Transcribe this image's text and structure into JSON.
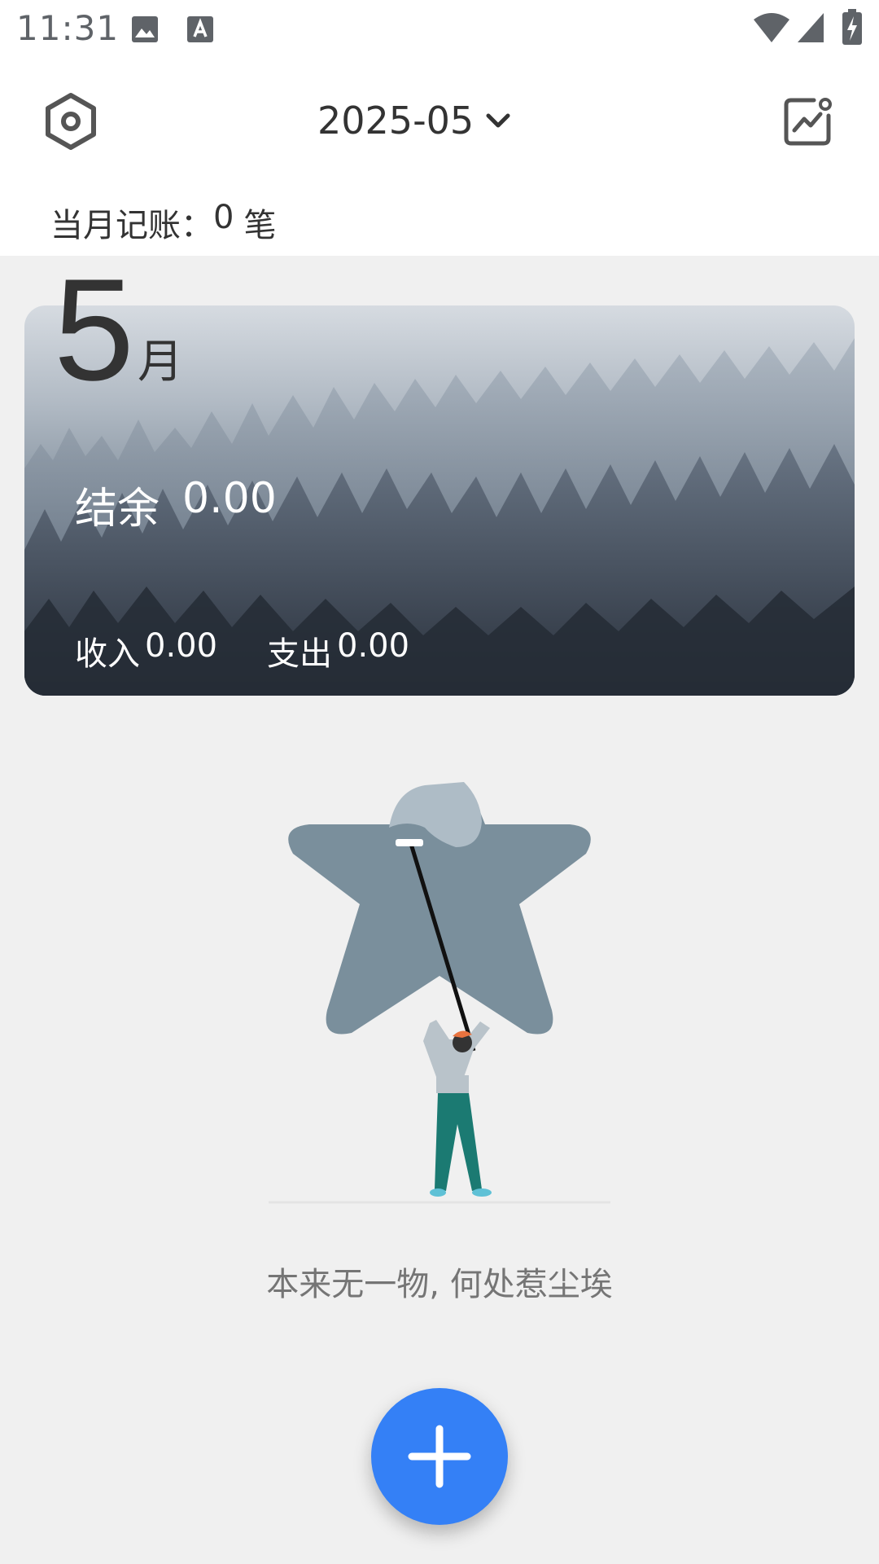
{
  "status_bar": {
    "time": "11:31",
    "icons": [
      "image-icon",
      "text-a-icon",
      "wifi-icon",
      "signal-icon",
      "battery-charging-icon"
    ]
  },
  "header": {
    "settings_icon": "settings-icon",
    "month": "2025-05",
    "dropdown_icon": "chevron-down-icon",
    "stats_icon": "stats-chart-icon",
    "record_count_label": "当月记账：",
    "record_count_value": "0",
    "record_count_unit": "笔"
  },
  "card": {
    "month_number": "5",
    "month_unit": "月",
    "balance_label": "结余",
    "balance_value": "0.00",
    "income_label": "收入",
    "income_value": "0.00",
    "expense_label": "支出",
    "expense_value": "0.00"
  },
  "empty_state": {
    "illustration": "person-cleaning-star-illustration",
    "message": "本来无一物, 何处惹尘埃"
  },
  "fab": {
    "icon": "plus-icon"
  },
  "colors": {
    "fab": "#3480f6",
    "background": "#f0f0f0",
    "header_bg": "#ffffff",
    "star": "#7a8f9c"
  }
}
